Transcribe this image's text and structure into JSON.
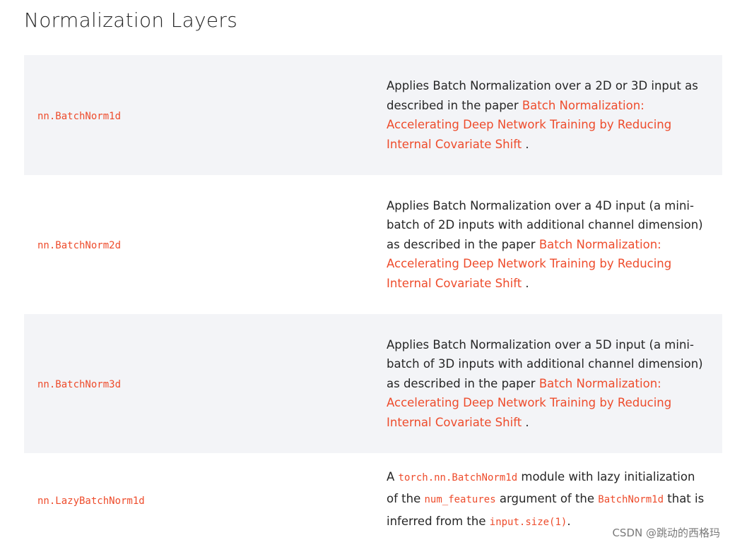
{
  "page": {
    "title": "Normalization Layers"
  },
  "rows": [
    {
      "name": "nn.BatchNorm1d",
      "desc_prefix": "Applies Batch Normalization over a 2D or 3D input as described in the paper",
      "paper_link": "Batch Normalization: Accelerating Deep Network Training by Reducing Internal Covariate Shift",
      "desc_suffix": " ."
    },
    {
      "name": "nn.BatchNorm2d",
      "desc_prefix": "Applies Batch Normalization over a 4D input (a mini-batch of 2D inputs with additional channel dimension) as described in the paper",
      "paper_link": "Batch Normalization: Accelerating Deep Network Training by Reducing Internal Covariate Shift",
      "desc_suffix": " ."
    },
    {
      "name": "nn.BatchNorm3d",
      "desc_prefix": "Applies Batch Normalization over a 5D input (a mini-batch of 3D inputs with additional channel dimension) as described in the paper",
      "paper_link": "Batch Normalization: Accelerating Deep Network Training by Reducing Internal Covariate Shift",
      "desc_suffix": " ."
    },
    {
      "name": "nn.LazyBatchNorm1d",
      "text_a": "A ",
      "code_a": "torch.nn.BatchNorm1d",
      "text_b": " module with lazy initialization of the ",
      "code_b": "num_features",
      "text_c": " argument of the ",
      "code_c": "BatchNorm1d",
      "text_d": " that is inferred from the ",
      "code_d": "input.size(1)",
      "text_e": "."
    }
  ],
  "watermark": "CSDN @跳动的西格玛",
  "colors": {
    "accent": "#ee4c2c",
    "row_shade": "#f3f4f7",
    "text": "#262626"
  }
}
